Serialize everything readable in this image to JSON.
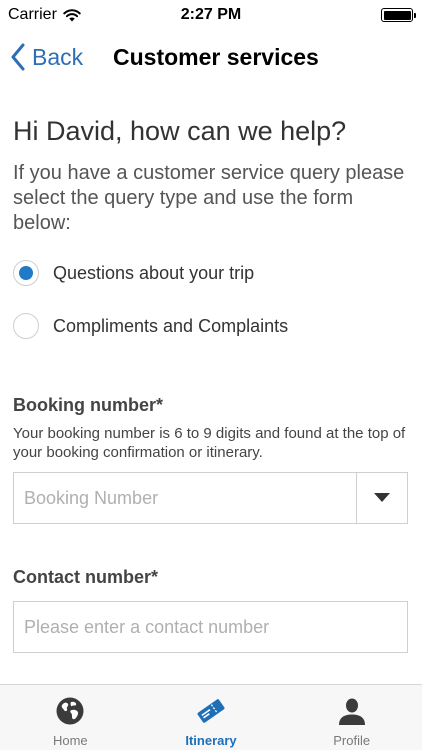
{
  "status_bar": {
    "carrier": "Carrier",
    "time": "2:27 PM",
    "battery_level": 1.0
  },
  "nav": {
    "back_label": "Back",
    "title": "Customer services"
  },
  "main": {
    "greeting": "Hi David, how can we help?",
    "intro": "If you have a customer service query please select the query type and use the form below:",
    "query_types": [
      {
        "label": "Questions about your trip",
        "selected": true
      },
      {
        "label": "Compliments and Complaints",
        "selected": false
      }
    ],
    "booking": {
      "label": "Booking number*",
      "help": "Your booking number is 6 to 9 digits and found at the top of your booking confirmation or itinerary.",
      "placeholder": "Booking Number",
      "value": ""
    },
    "contact": {
      "label": "Contact number*",
      "placeholder": "Please enter a contact number",
      "value": ""
    }
  },
  "tabs": [
    {
      "label": "Home",
      "icon": "globe-icon",
      "active": false
    },
    {
      "label": "Itinerary",
      "icon": "ticket-icon",
      "active": true
    },
    {
      "label": "Profile",
      "icon": "person-icon",
      "active": false
    }
  ],
  "colors": {
    "accent": "#1f7ac8",
    "link": "#2c6fb5",
    "tab_active": "#1e6fb8",
    "tab_inactive": "#7a7a7a",
    "border": "#cfcfcf"
  }
}
